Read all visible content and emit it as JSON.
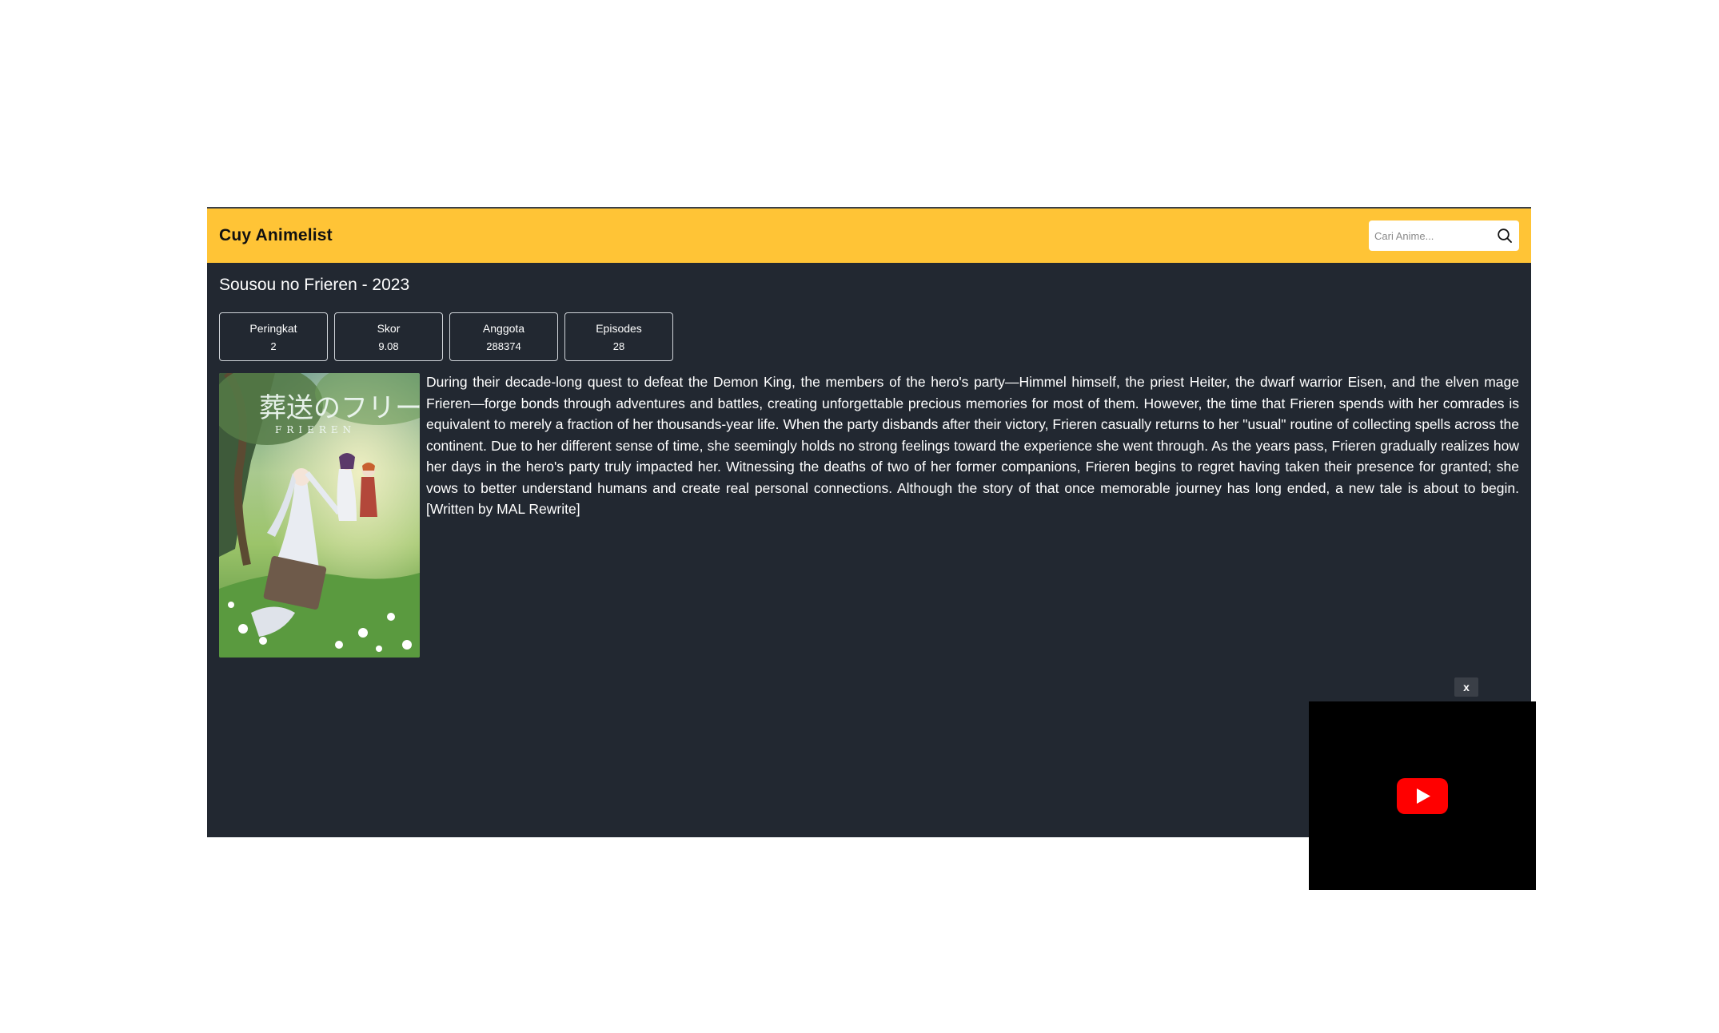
{
  "navbar": {
    "brand": "Cuy Animelist",
    "search": {
      "placeholder": "Cari Anime...",
      "value": ""
    },
    "accent_color": "#FFC436"
  },
  "anime": {
    "title_line": "Sousou no Frieren - 2023",
    "stats": [
      {
        "label": "Peringkat",
        "value": "2"
      },
      {
        "label": "Skor",
        "value": "9.08"
      },
      {
        "label": "Anggota",
        "value": "288374"
      },
      {
        "label": "Episodes",
        "value": "28"
      }
    ],
    "poster_title": "葬送のフリーレン",
    "poster_subtitle": "FRIEREN",
    "synopsis": "During their decade-long quest to defeat the Demon King, the members of the hero's party—Himmel himself, the priest Heiter, the dwarf warrior Eisen, and the elven mage Frieren—forge bonds through adventures and battles, creating unforgettable precious memories for most of them. However, the time that Frieren spends with her comrades is equivalent to merely a fraction of her thousands-year life. When the party disbands after their victory, Frieren casually returns to her \"usual\" routine of collecting spells across the continent. Due to her different sense of time, she seemingly holds no strong feelings toward the experience she went through. As the years pass, Frieren gradually realizes how her days in the hero's party truly impacted her. Witnessing the deaths of two of her former companions, Frieren begins to regret having taken their presence for granted; she vows to better understand humans and create real personal connections. Although the story of that once memorable journey has long ended, a new tale is about to begin. [Written by MAL Rewrite]"
  },
  "video": {
    "close_label": "x",
    "play_icon": "youtube-play-icon"
  },
  "colors": {
    "background": "#222831",
    "navbar": "#FFC436",
    "youtube_red": "#FF0000"
  }
}
